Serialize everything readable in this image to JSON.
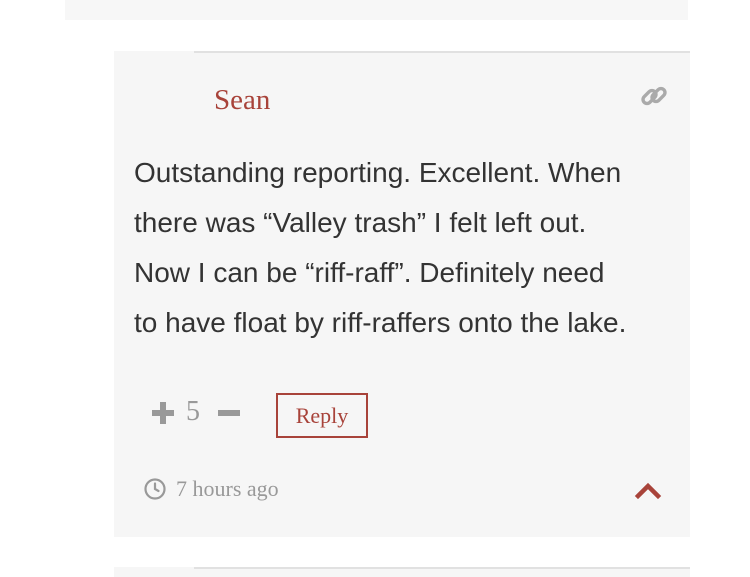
{
  "comment": {
    "author": "Sean",
    "body_lines": [
      "Outstanding reporting. Excellent. When",
      "there was “Valley trash” I felt left out.",
      "Now I can be “riff-raff”. Definitely need",
      "to have float by riff-raffers onto the lake."
    ],
    "votes": "5",
    "reply_label": "Reply",
    "time_ago": "7 hours ago"
  },
  "icons": {
    "permalink": "link-icon",
    "upvote": "plus-icon",
    "downvote": "minus-icon",
    "time": "clock-icon",
    "collapse": "chevron-up-icon"
  },
  "colors": {
    "accent": "#a8433a",
    "card_background": "#f6f6f6",
    "text": "#333333",
    "muted": "#999999"
  }
}
